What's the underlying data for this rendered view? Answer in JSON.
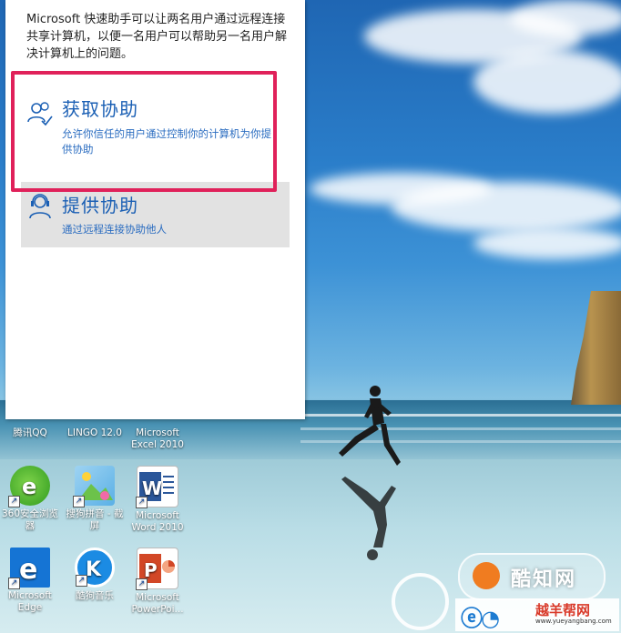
{
  "assist_panel": {
    "intro": "Microsoft 快速助手可以让两名用户通过远程连接共享计算机，以便一名用户可以帮助另一名用户解决计算机上的问题。",
    "get_help": {
      "title": "获取协助",
      "description": "允许你信任的用户通过控制你的计算机为你提供协助",
      "icon": "people-check-icon"
    },
    "give_help": {
      "title": "提供协助",
      "description": "通过远程连接协助他人",
      "icon": "headset-person-icon"
    }
  },
  "desktop_icons": {
    "row_top_labels": [
      "腾讯QQ",
      "LINGO 12.0",
      "Microsoft Excel 2010"
    ],
    "row1": [
      {
        "label": "360安全浏览器",
        "icon": "360-browser-icon"
      },
      {
        "label": "搜狗拼音 - 截屏",
        "icon": "sogou-screenshot-icon"
      },
      {
        "label": "Microsoft Word 2010",
        "icon": "word-icon"
      }
    ],
    "row2": [
      {
        "label": "Microsoft Edge",
        "icon": "edge-icon"
      },
      {
        "label": "酷狗音乐",
        "icon": "kugou-icon"
      },
      {
        "label": "Microsoft PowerPoi...",
        "icon": "powerpoint-icon"
      }
    ]
  },
  "watermarks": {
    "site1": "酷知网",
    "site2_name": "越羊帮网",
    "site2_url": "www.yueyangbang.com"
  },
  "colors": {
    "accent": "#1a5fb4",
    "highlight_border": "#e0215a"
  }
}
